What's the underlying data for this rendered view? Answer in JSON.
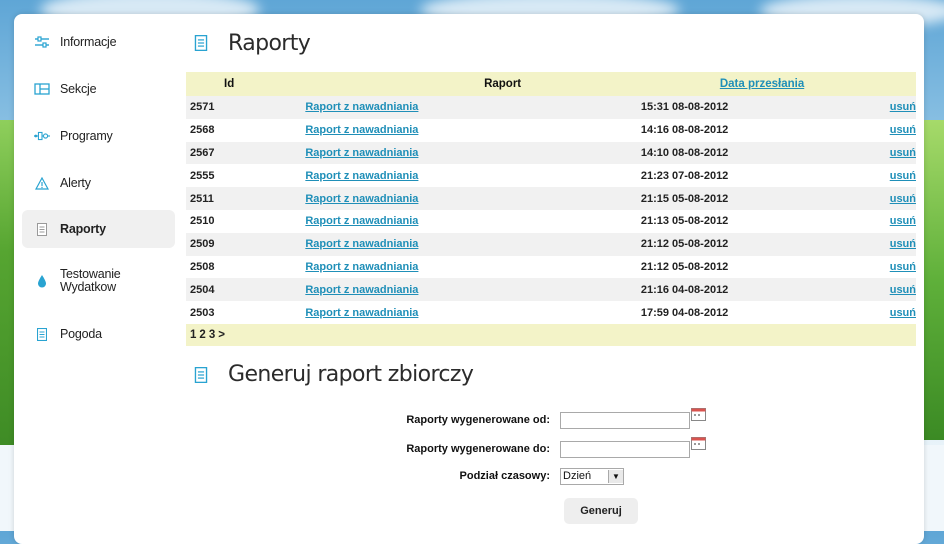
{
  "sidebar": {
    "items": [
      {
        "label": "Informacje",
        "icon": "sliders-icon"
      },
      {
        "label": "Sekcje",
        "icon": "sections-icon"
      },
      {
        "label": "Programy",
        "icon": "programs-icon"
      },
      {
        "label": "Alerty",
        "icon": "warning-icon"
      },
      {
        "label": "Raporty",
        "icon": "report-icon",
        "active": true
      },
      {
        "label": "Testowanie Wydatkow",
        "icon": "water-drop-icon"
      },
      {
        "label": "Pogoda",
        "icon": "document-icon"
      }
    ]
  },
  "reports": {
    "title": "Raporty",
    "columns": {
      "id": "Id",
      "report": "Raport",
      "date": "Data przesłania"
    },
    "rows": [
      {
        "id": "2571",
        "report": "Raport z nawadniania",
        "date": "15:31 08-08-2012",
        "action": "usuń"
      },
      {
        "id": "2568",
        "report": "Raport z nawadniania",
        "date": "14:16 08-08-2012",
        "action": "usuń"
      },
      {
        "id": "2567",
        "report": "Raport z nawadniania",
        "date": "14:10 08-08-2012",
        "action": "usuń"
      },
      {
        "id": "2555",
        "report": "Raport z nawadniania",
        "date": "21:23 07-08-2012",
        "action": "usuń"
      },
      {
        "id": "2511",
        "report": "Raport z nawadniania",
        "date": "21:15 05-08-2012",
        "action": "usuń"
      },
      {
        "id": "2510",
        "report": "Raport z nawadniania",
        "date": "21:13 05-08-2012",
        "action": "usuń"
      },
      {
        "id": "2509",
        "report": "Raport z nawadniania",
        "date": "21:12 05-08-2012",
        "action": "usuń"
      },
      {
        "id": "2508",
        "report": "Raport z nawadniania",
        "date": "21:12 05-08-2012",
        "action": "usuń"
      },
      {
        "id": "2504",
        "report": "Raport z nawadniania",
        "date": "21:16 04-08-2012",
        "action": "usuń"
      },
      {
        "id": "2503",
        "report": "Raport z nawadniania",
        "date": "17:59 04-08-2012",
        "action": "usuń"
      }
    ],
    "pager": [
      "1",
      "2",
      "3",
      ">"
    ]
  },
  "generate": {
    "title": "Generuj raport zbiorczy",
    "from_label": "Raporty wygenerowane od:",
    "from_value": "",
    "to_label": "Raporty wygenerowane do:",
    "to_value": "",
    "split_label": "Podział czasowy:",
    "split_value": "Dzień",
    "button_label": "Generuj"
  },
  "colors": {
    "accent": "#1f8fb8",
    "header_bg": "#f3f3c8",
    "row_alt": "#f1f1f1"
  }
}
